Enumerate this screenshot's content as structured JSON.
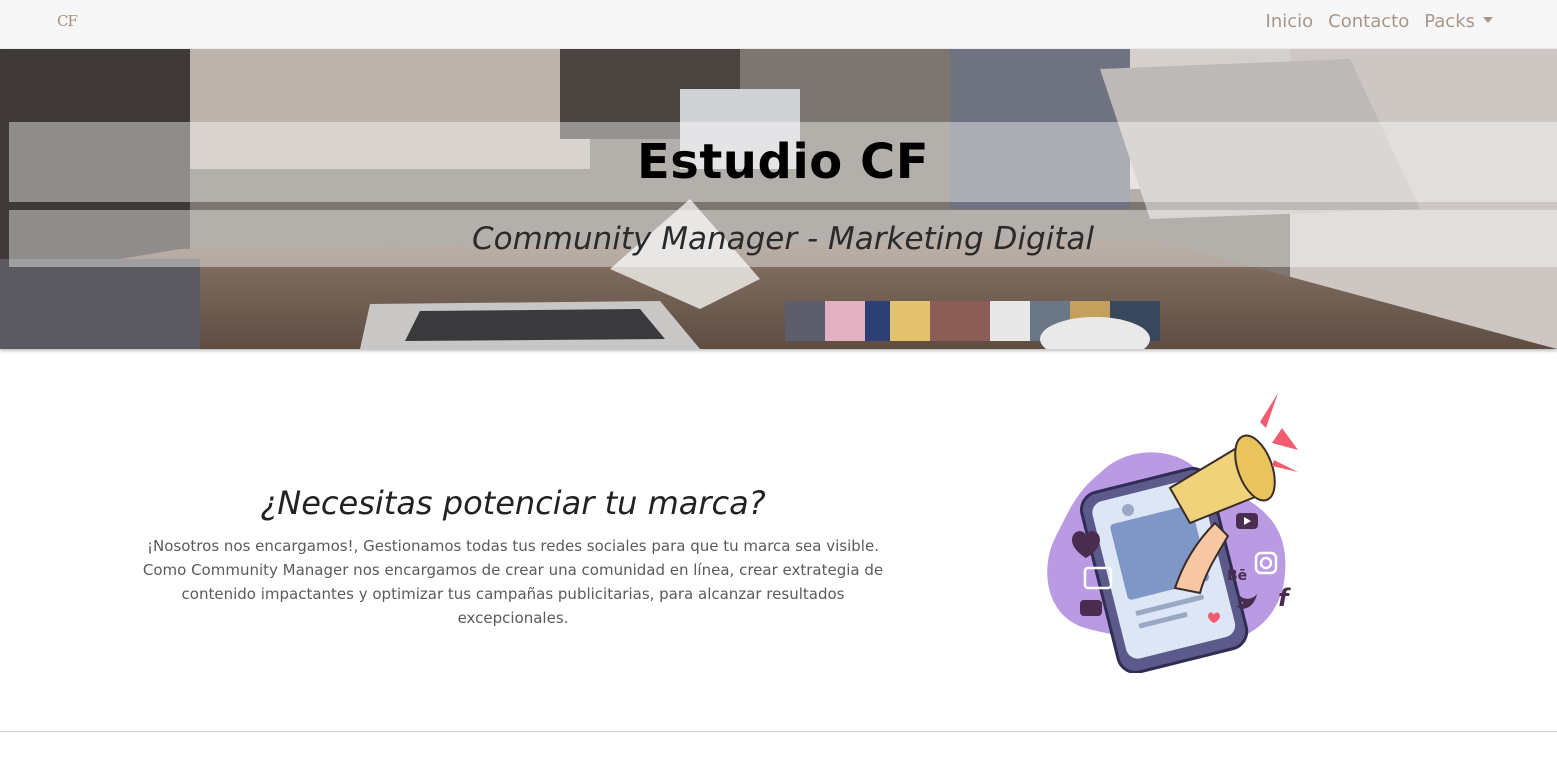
{
  "navbar": {
    "brand_text": "CF",
    "brand_dot": "·",
    "links": [
      {
        "label": "Inicio"
      },
      {
        "label": "Contacto"
      },
      {
        "label": "Packs"
      }
    ],
    "brand_color": "#a8927f",
    "link_color": "#a99689"
  },
  "hero": {
    "title": "Estudio CF",
    "subtitle": "Community Manager - Marketing Digital"
  },
  "intro": {
    "heading": "¿Necesitas potenciar tu marca?",
    "body": "¡Nosotros nos encargamos!, Gestionamos todas tus redes sociales para que tu marca sea visible. Como Community Manager nos encargamos de crear una comunidad en línea, crear extrategia de contenido impactantes y optimizar tus campañas publicitarias, para alcanzar resultados excepcionales."
  },
  "illustration": {
    "icons": [
      "megaphone-icon",
      "phone-icon",
      "heart-icon",
      "like-icon",
      "chat-icon",
      "youtube-icon",
      "instagram-icon",
      "behance-icon",
      "twitter-icon",
      "facebook-icon"
    ],
    "behance_label": "Bē",
    "facebook_label": "f",
    "blob_color": "#b99ae3",
    "accent_color": "#f25c6e"
  }
}
